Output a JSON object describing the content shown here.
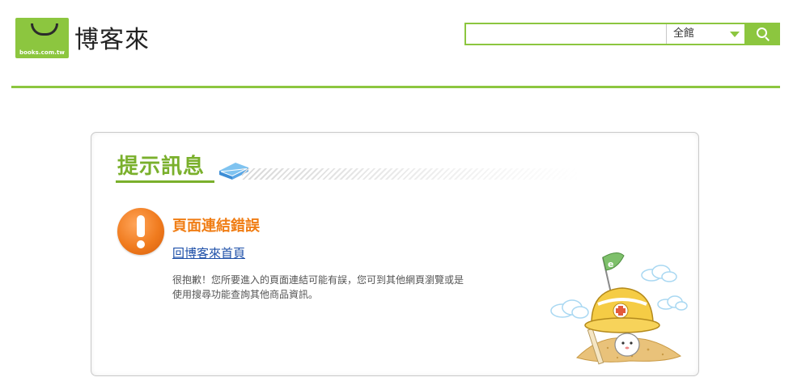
{
  "header": {
    "logo_domain": "books.com.tw",
    "logo_text": "博客來",
    "search": {
      "value": "",
      "placeholder": "",
      "scope_selected": "全館",
      "button_icon": "search-icon"
    }
  },
  "panel": {
    "title": "提示訊息",
    "error_title": "頁面連結錯誤",
    "home_link": "回博客來首頁",
    "message_line1": "很抱歉！您所要進入的頁面連結可能有誤，您可到其他網頁瀏覽或是",
    "message_line2": "使用搜尋功能查詢其他商品資訊。"
  },
  "colors": {
    "brand_green": "#8cc63f",
    "title_green": "#7ab02c",
    "error_orange": "#f07d14",
    "link_blue": "#1d4fa8"
  },
  "icons": [
    "shopping-bag-logo-icon",
    "search-icon",
    "chevron-down-icon",
    "book-icon",
    "warning-icon"
  ]
}
